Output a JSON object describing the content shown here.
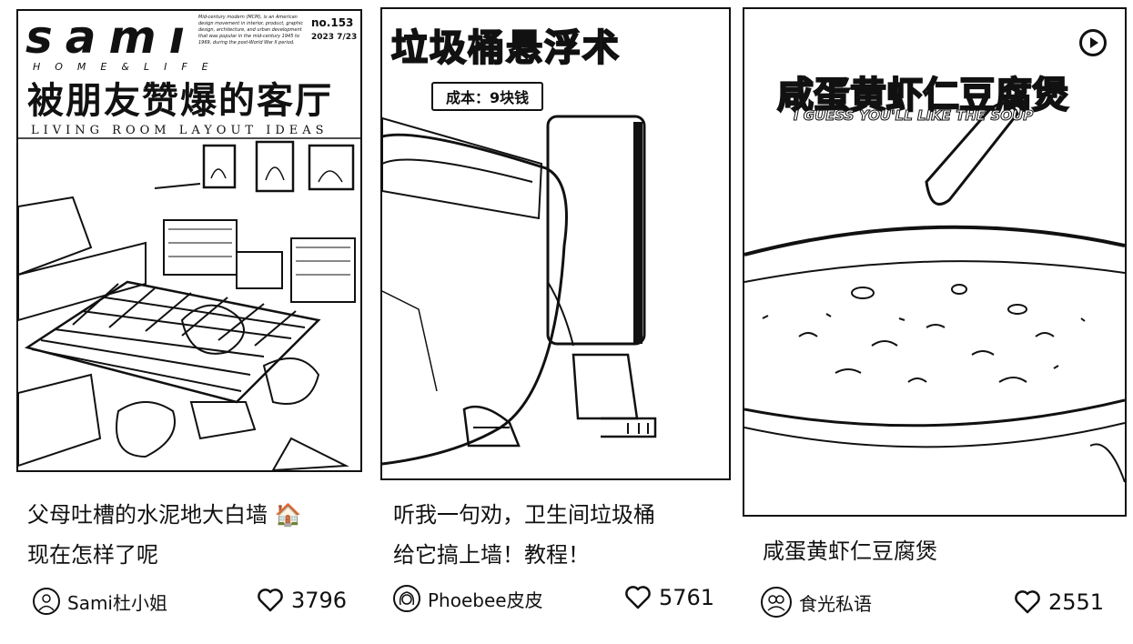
{
  "cards": [
    {
      "cover": {
        "brand": "samı",
        "brand_sub": "HOME&LIFE",
        "issue_no": "no.153",
        "issue_date": "2023 7/23",
        "blurb": "Mid-century modern (MCM), is an American design movement in interior, product, graphic design, architecture, and urban development that was popular in the mid-century 1945 to 1969, during the post-World War II period.",
        "headline": "被朋友赞爆的客厅",
        "subline": "LIVING ROOM LAYOUT IDEAS"
      },
      "title_lines": [
        "父母吐槽的水泥地大白墙",
        "现在怎样了呢"
      ],
      "title_emoji": "🏠",
      "author": "Sami杜小姐",
      "likes": "3796"
    },
    {
      "cover": {
        "headline": "垃圾桶悬浮术",
        "cost_tag": "成本：9块钱"
      },
      "title_lines": [
        "听我一句劝，卫生间垃圾桶",
        "给它搞上墙！教程！"
      ],
      "author": "Phoebee皮皮",
      "likes": "5761"
    },
    {
      "cover": {
        "headline": "咸蛋黄虾仁豆腐煲",
        "subline": "I GUESS YOU'LL LIKE THE SOUP",
        "video_icon": "play-icon"
      },
      "title_lines": [
        "咸蛋黄虾仁豆腐煲"
      ],
      "author": "食光私语",
      "likes": "2551"
    }
  ],
  "icons": {
    "like": "heart-outline-icon",
    "video": "play-icon"
  }
}
